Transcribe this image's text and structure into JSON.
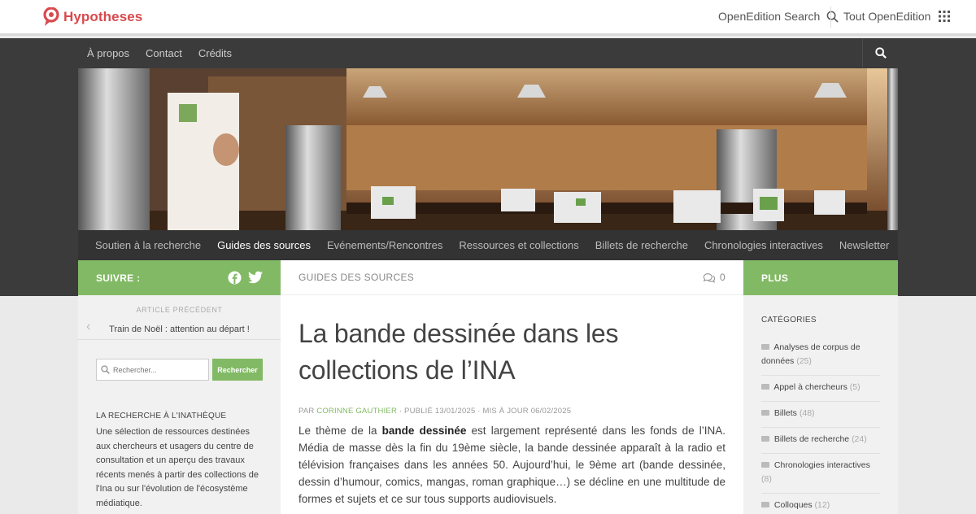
{
  "brand": {
    "name": "Hypotheses"
  },
  "openedition": {
    "search_label": "OpenEdition Search",
    "all_label": "Tout OpenEdition"
  },
  "top_nav": [
    "À propos",
    "Contact",
    "Crédits"
  ],
  "main_nav": [
    {
      "label": "Soutien à la recherche",
      "active": false
    },
    {
      "label": "Guides des sources",
      "active": true
    },
    {
      "label": "Evénements/Rencontres",
      "active": false
    },
    {
      "label": "Ressources et collections",
      "active": false
    },
    {
      "label": "Billets de recherche",
      "active": false
    },
    {
      "label": "Chronologies interactives",
      "active": false
    },
    {
      "label": "Newsletter",
      "active": false
    }
  ],
  "left": {
    "follow_label": "SUIVRE :",
    "prev_label": "ARTICLE PRÉCÉDENT",
    "prev_title": "Train de Noël : attention au départ !",
    "search_placeholder": "Rechercher...",
    "search_button": "Rechercher",
    "widget_title": "LA RECHERCHE À L'INATHÈQUE",
    "widget_text": "Une sélection de ressources destinées aux chercheurs et usagers du centre de consultation et un aperçu des travaux récents menés à partir des collections de l'Ina ou sur l'évolution de l'écosystème médiatique."
  },
  "post": {
    "category": "GUIDES DES SOURCES",
    "comment_count": "0",
    "title": "La bande dessinée dans les collections de l’INA",
    "byline_prefix": "PAR",
    "author": "CORINNE GAUTHIER",
    "byline_dates": "· PUBLIÉ 13/01/2025 · MIS À JOUR 06/02/2025",
    "body_before": "Le thème de la",
    "body_bold": "bande dessinée",
    "body_after": "est largement représenté dans les fonds de l’INA. Média de masse dès la fin du 19ème siècle, la bande dessinée apparaît à la radio et télévision françaises dans les années 50. Aujourd’hui, le 9ème art (bande dessinée, dessin d’humour, comics, mangas, roman graphique…) se décline en une multitude de formes et sujets et ce sur tous supports audiovisuels."
  },
  "right": {
    "plus_label": "PLUS",
    "categories_title": "CATÉGORIES",
    "categories": [
      {
        "label": "Analyses de corpus de données",
        "count": "(25)"
      },
      {
        "label": "Appel à chercheurs",
        "count": "(5)"
      },
      {
        "label": "Billets",
        "count": "(48)"
      },
      {
        "label": "Billets de recherche",
        "count": "(24)"
      },
      {
        "label": "Chronologies interactives",
        "count": "(8)"
      },
      {
        "label": "Colloques",
        "count": "(12)"
      }
    ]
  },
  "colors": {
    "accent": "#82b965",
    "brand_red": "#d84a4e",
    "dark": "#3b3b3b"
  }
}
